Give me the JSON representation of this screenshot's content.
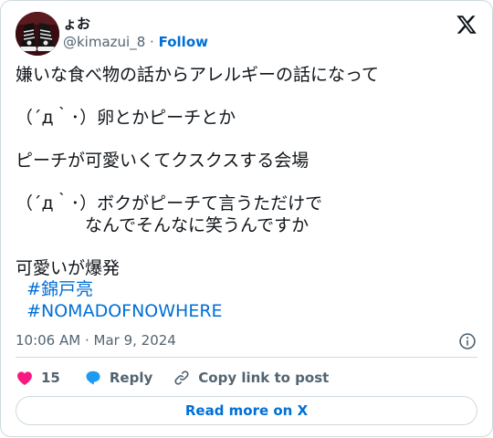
{
  "user": {
    "display_name": "ょお",
    "handle": "@kimazui_8",
    "separator": "·",
    "follow_label": "Follow"
  },
  "tweet": {
    "lines": [
      "嫌いな食べ物の話からアレルギーの話になって",
      "",
      "（´д｀･）卵とかピーチとか",
      "",
      "ピーチが可愛いくてクスクスする会場",
      "",
      "（´д｀･）ボクがピーチて言うただけで",
      "　　　　なんでそんなに笑うんですか",
      "",
      "可愛いが爆発"
    ],
    "hashtags": [
      "#錦戸亮",
      "#NOMADOFNOWHERE"
    ],
    "timestamp": "10:06 AM · Mar 9, 2024"
  },
  "actions": {
    "like_count": "15",
    "reply_label": "Reply",
    "copy_label": "Copy link to post"
  },
  "footer": {
    "read_more_label": "Read more on X"
  },
  "colors": {
    "link_blue": "#006fd6",
    "heart_pink": "#f91880",
    "reply_blue": "#1d9bf0",
    "muted": "#536471",
    "border": "#cfd9de"
  }
}
